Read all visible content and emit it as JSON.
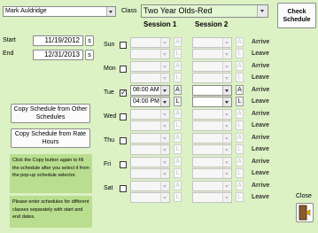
{
  "employee": {
    "value": "Mark Auldridge"
  },
  "class_label": "Class",
  "class_select": {
    "value": "Two Year Olds-Red"
  },
  "check_schedule_label": "Check Schedule",
  "start": {
    "label": "Start",
    "value": "11/19/2012",
    "button": "s"
  },
  "end": {
    "label": "End",
    "value": "12/31/2013",
    "button": "s"
  },
  "session1_label": "Session 1",
  "session2_label": "Session 2",
  "arrive_label": "Arrive",
  "leave_label": "Leave",
  "spin_up": "A",
  "spin_down": "L",
  "days": [
    {
      "name": "Sun",
      "checked": false,
      "s1_arrive": "",
      "s1_leave": "",
      "s2_arrive": "",
      "s2_leave": ""
    },
    {
      "name": "Mon",
      "checked": false,
      "s1_arrive": "",
      "s1_leave": "",
      "s2_arrive": "",
      "s2_leave": ""
    },
    {
      "name": "Tue",
      "checked": true,
      "s1_arrive": "08:00 AM",
      "s1_leave": "04:00 PM",
      "s2_arrive": "",
      "s2_leave": ""
    },
    {
      "name": "Wed",
      "checked": false,
      "s1_arrive": "",
      "s1_leave": "",
      "s2_arrive": "",
      "s2_leave": ""
    },
    {
      "name": "Thu",
      "checked": false,
      "s1_arrive": "",
      "s1_leave": "",
      "s2_arrive": "",
      "s2_leave": ""
    },
    {
      "name": "Fri",
      "checked": false,
      "s1_arrive": "",
      "s1_leave": "",
      "s2_arrive": "",
      "s2_leave": ""
    },
    {
      "name": "Sat",
      "checked": false,
      "s1_arrive": "",
      "s1_leave": "",
      "s2_arrive": "",
      "s2_leave": ""
    }
  ],
  "copy_other_label": "Copy Schedule from Other Schedules",
  "copy_rate_label": "Copy Schedule from Rate Hours",
  "note1": "Click the Copy button again to fill the schedule after you select it from the pop-up schedule selector.",
  "note2": "Please enter schedules for different classes separately with start and end dates.",
  "close_label": "Close",
  "icons": {
    "close": "exit-door-icon"
  },
  "colors": {
    "background": "#dcf1c4",
    "note_background": "#b9de8f",
    "class_field": "#e4f7d4"
  }
}
